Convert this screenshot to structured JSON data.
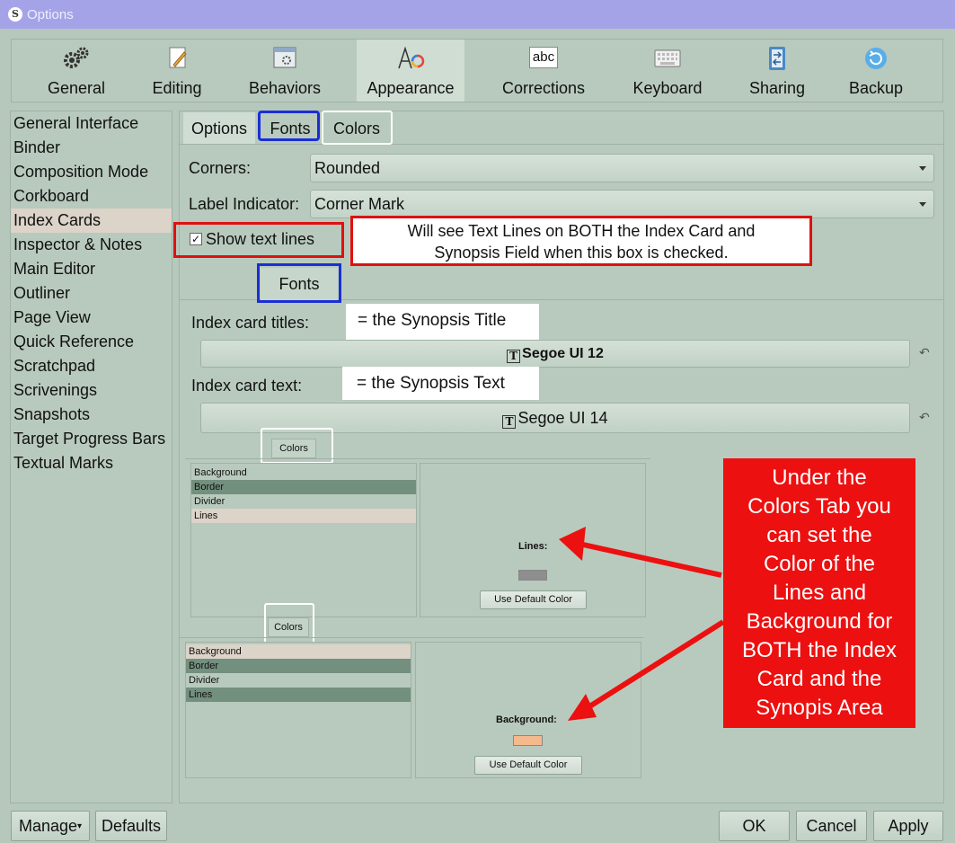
{
  "window": {
    "title": "Options",
    "app_icon_letter": "S"
  },
  "toolbar": [
    {
      "label": "General",
      "icon": "gears-icon"
    },
    {
      "label": "Editing",
      "icon": "pencil-icon"
    },
    {
      "label": "Behaviors",
      "icon": "behaviors-icon"
    },
    {
      "label": "Appearance",
      "icon": "appearance-icon",
      "selected": true
    },
    {
      "label": "Corrections",
      "icon": "abc-icon",
      "icon_text": "abc"
    },
    {
      "label": "Keyboard",
      "icon": "keyboard-icon"
    },
    {
      "label": "Sharing",
      "icon": "sharing-icon"
    },
    {
      "label": "Backup",
      "icon": "backup-icon"
    }
  ],
  "sidebar": {
    "items": [
      "General Interface",
      "Binder",
      "Composition Mode",
      "Corkboard",
      "Index Cards",
      "Inspector & Notes",
      "Main Editor",
      "Outliner",
      "Page View",
      "Quick Reference",
      "Scratchpad",
      "Scrivenings",
      "Snapshots",
      "Target Progress Bars",
      "Textual Marks"
    ],
    "selected": "Index Cards"
  },
  "tabs": {
    "options": "Options",
    "fonts": "Fonts",
    "colors": "Colors"
  },
  "options": {
    "corners_label": "Corners:",
    "corners_value": "Rounded",
    "label_indicator_label": "Label Indicator:",
    "label_indicator_value": "Corner Mark",
    "show_text_lines_label": "Show text lines",
    "show_text_lines_checked": true,
    "check_glyph": "✓"
  },
  "fonts_section": {
    "tab_label": "Fonts",
    "titles_label": "Index card titles:",
    "titles_font": "Segoe UI 12",
    "text_label": "Index card text:",
    "text_font": "Segoe UI 14",
    "font_glyph": "T",
    "reset_glyph": "↶"
  },
  "callouts": {
    "text_lines_note": "Will see Text Lines on BOTH the Index Card and Synopsis Field when this box is checked.",
    "text_lines_note_line1": "Will see Text Lines on BOTH the Index Card and",
    "text_lines_note_line2": "Synopsis Field when this box is checked.",
    "synopsis_title": "= the Synopsis Title",
    "synopsis_text": "= the Synopsis Text",
    "colors_note_lines": [
      "Under the",
      "Colors Tab you",
      "can set the",
      "Color of the",
      "Lines and",
      "Background for",
      "BOTH the Index",
      "Card and the",
      "Synopis Area"
    ]
  },
  "colors_panel_1": {
    "tab_label": "Colors",
    "items": [
      "Background",
      "Border",
      "Divider",
      "Lines"
    ],
    "selected": "Lines",
    "preview_label": "Lines:",
    "swatch_color": "#8e8e8e",
    "default_button": "Use Default Color"
  },
  "colors_panel_2": {
    "tab_label": "Colors",
    "items": [
      "Background",
      "Border",
      "Divider",
      "Lines"
    ],
    "selected": "Background",
    "preview_label": "Background:",
    "swatch_color": "#f5b98e",
    "default_button": "Use Default Color"
  },
  "buttons": {
    "manage": "Manage",
    "manage_arrow": "▾",
    "defaults": "Defaults",
    "ok": "OK",
    "cancel": "Cancel",
    "apply": "Apply"
  },
  "colors": {
    "accent_red": "#e01010",
    "accent_blue": "#1a2ed6",
    "titlebar": "#a5a3e8",
    "panel_bg": "#b8cabd",
    "selection_light": "#dcd3c9",
    "selection_dark": "#738f7e"
  }
}
